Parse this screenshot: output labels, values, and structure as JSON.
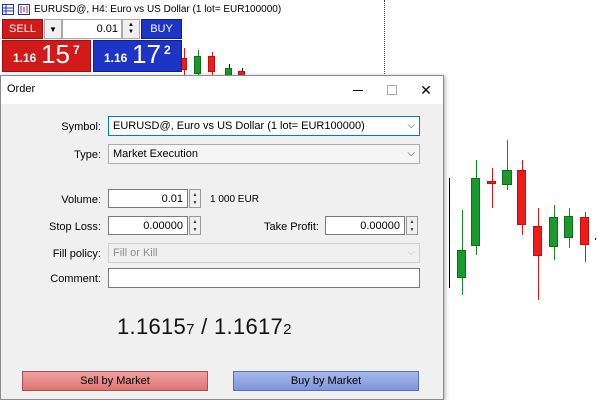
{
  "chart_header": {
    "title": "EURUSD@, H4:  Euro vs US Dollar (1 lot= EUR100000)",
    "icons": [
      "table-icon",
      "chart-icon"
    ]
  },
  "one_click": {
    "sell_label": "SELL",
    "buy_label": "BUY",
    "volume": "0.01",
    "sell_prefix": "1.16",
    "sell_main": "15",
    "sell_sup": "7",
    "buy_prefix": "1.16",
    "buy_main": "17",
    "buy_sup": "2",
    "colors": {
      "sell": "#d21a1a",
      "buy": "#1c35c6"
    }
  },
  "dialog": {
    "title": "Order",
    "controls": [
      "minimize-icon",
      "maximize-icon",
      "close-icon"
    ],
    "symbol_label": "Symbol:",
    "symbol_value": "EURUSD@, Euro vs US Dollar (1 lot= EUR100000)",
    "type_label": "Type:",
    "type_value": "Market Execution",
    "volume_label": "Volume:",
    "volume_value": "0.01",
    "volume_unit": "1 000 EUR",
    "stop_loss_label": "Stop Loss:",
    "stop_loss_value": "0.00000",
    "take_profit_label": "Take Profit:",
    "take_profit_value": "0.00000",
    "fill_policy_label": "Fill policy:",
    "fill_policy_value": "Fill or Kill",
    "comment_label": "Comment:",
    "comment_value": "",
    "bid_main": "1.1615",
    "bid_small": "7",
    "separator": " / ",
    "ask_main": "1.1617",
    "ask_small": "2",
    "sell_button": "Sell by Market",
    "buy_button": "Buy by Market"
  }
}
